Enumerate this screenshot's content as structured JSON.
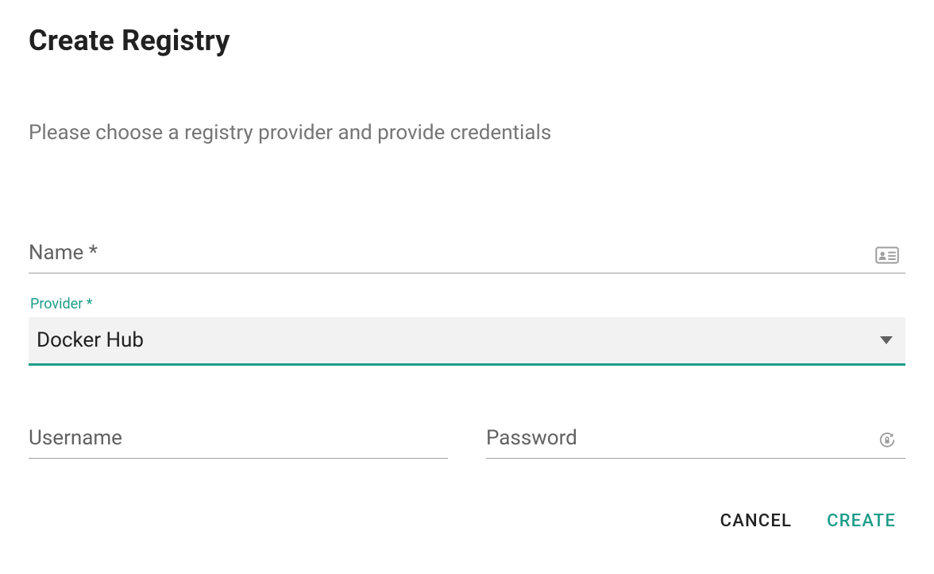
{
  "header": {
    "title": "Create Registry",
    "subtitle": "Please choose a registry provider and provide credentials"
  },
  "form": {
    "name": {
      "placeholder": "Name *",
      "value": ""
    },
    "provider": {
      "label": "Provider *",
      "value": "Docker Hub"
    },
    "username": {
      "placeholder": "Username",
      "value": ""
    },
    "password": {
      "placeholder": "Password",
      "value": ""
    }
  },
  "actions": {
    "cancel": "CANCEL",
    "create": "CREATE"
  },
  "colors": {
    "accent": "#1d9d89",
    "textMuted": "#757575",
    "iconMuted": "#9e9e9e"
  }
}
